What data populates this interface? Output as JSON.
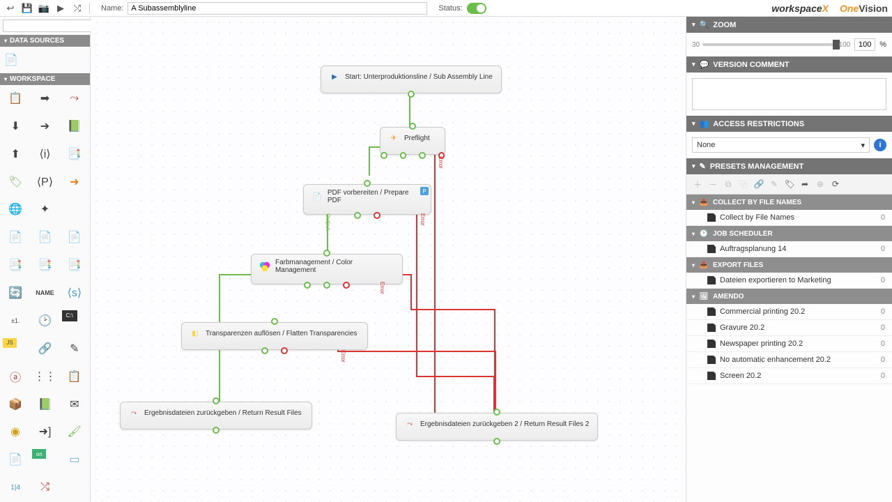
{
  "header": {
    "name_label": "Name:",
    "name_value": "A Subassemblyline",
    "status_label": "Status:",
    "logo1_a": "workspace",
    "logo1_b": "X",
    "logo2_a": "One",
    "logo2_b": "Vision"
  },
  "search": {
    "placeholder": ""
  },
  "left": {
    "data_sources": "DATA SOURCES",
    "workspace": "WORKSPACE"
  },
  "nodes": {
    "start": "Start: Unterproduktionsline / Sub Assembly Line",
    "preflight": "Preflight",
    "prepare": "PDF vorbereiten / Prepare PDF",
    "color": "Farbmanagement / Color Management",
    "flatten": "Transparenzen auflösen / Flatten Transparencies",
    "result1": "Ergebnisdateien zurückgeben / Return Result Files",
    "result2": "Ergebnisdateien zurückgeben 2 / Return Result Files 2"
  },
  "edge_labels": {
    "output": "Output",
    "error": "Error"
  },
  "right": {
    "zoom_title": "ZOOM",
    "zoom_min": "30",
    "zoom_max": "100",
    "zoom_val": "100",
    "zoom_pct": "%",
    "comment_title": "VERSION COMMENT",
    "access_title": "ACCESS RESTRICTIONS",
    "access_value": "None",
    "presets_title": "PRESETS MANAGEMENT",
    "groups": [
      {
        "name": "COLLECT BY FILE NAMES",
        "icon": "collect",
        "items": [
          {
            "label": "Collect by File Names",
            "count": "0"
          }
        ]
      },
      {
        "name": "JOB SCHEDULER",
        "icon": "clock",
        "items": [
          {
            "label": "Auftragsplanung 14",
            "count": "0"
          }
        ]
      },
      {
        "name": "EXPORT FILES",
        "icon": "export",
        "items": [
          {
            "label": "Dateien exportieren to Marketing",
            "count": "0"
          }
        ]
      },
      {
        "name": "AMENDO",
        "icon": "amendo",
        "items": [
          {
            "label": "Commercial printing 20.2",
            "count": "0"
          },
          {
            "label": "Gravure 20.2",
            "count": "0"
          },
          {
            "label": "Newspaper printing 20.2",
            "count": "0"
          },
          {
            "label": "No automatic enhancement 20.2",
            "count": "0"
          },
          {
            "label": "Screen 20.2",
            "count": "0"
          }
        ]
      }
    ]
  }
}
